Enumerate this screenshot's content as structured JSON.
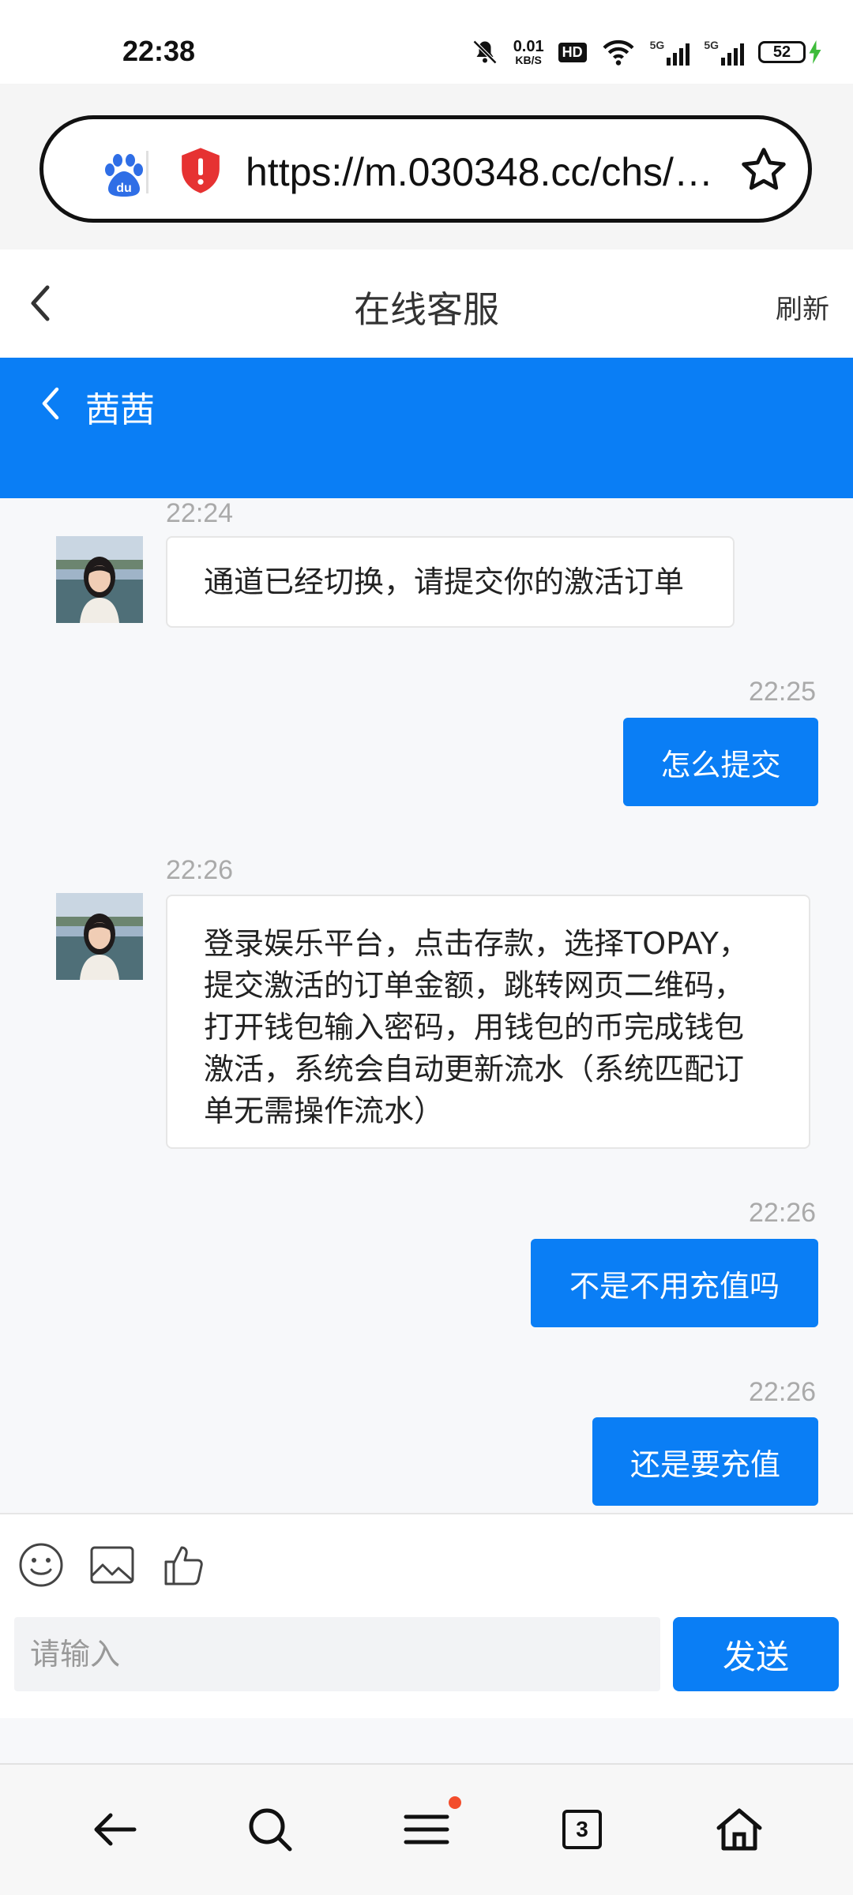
{
  "status_bar": {
    "time": "22:38",
    "net_speed_value": "0.01",
    "net_speed_unit": "KB/S",
    "hd_badge": "HD",
    "signal_1": "5G",
    "signal_2": "5G",
    "battery": "52"
  },
  "browser": {
    "url": "https://m.030348.cc/chs/…"
  },
  "page": {
    "title": "在线客服",
    "refresh_label": "刷新"
  },
  "chat_header": {
    "agent_name": "茜茜"
  },
  "messages": [
    {
      "from": "agent",
      "time": "22:24",
      "text": "通道已经切换，请提交你的激活订单"
    },
    {
      "from": "user",
      "time": "22:25",
      "text": "怎么提交"
    },
    {
      "from": "agent",
      "time": "22:26",
      "text": "登录娱乐平台，点击存款，选择TOPAY，提交激活的订单金额，跳转网页二维码，打开钱包输入密码，用钱包的币完成钱包激活，系统会自动更新流水（系统匹配订单无需操作流水）"
    },
    {
      "from": "user",
      "time": "22:26",
      "text": "不是不用充值吗"
    },
    {
      "from": "user",
      "time": "22:26",
      "text": "还是要充值"
    }
  ],
  "composer": {
    "placeholder": "请输入",
    "send_label": "发送",
    "tools": [
      "emoji-icon",
      "image-icon",
      "thumbs-up-icon"
    ]
  },
  "bottom_nav": {
    "tab_count": "3",
    "items": [
      "back-arrow-icon",
      "search-icon",
      "menu-icon",
      "tabs-icon",
      "home-icon"
    ]
  },
  "colors": {
    "accent": "#0a7ef5",
    "notification_dot": "#f34d2c",
    "charging": "#3dbb3a"
  }
}
